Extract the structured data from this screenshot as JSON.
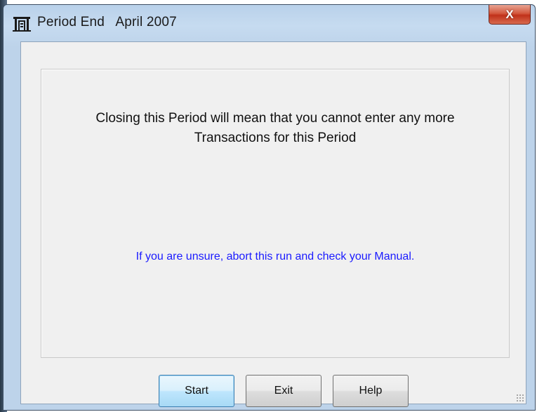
{
  "window": {
    "title": "Period End   April 2007",
    "close_label": "X"
  },
  "message": {
    "line1": "Closing this Period will mean that you cannot enter any more",
    "line2": "Transactions for this Period",
    "hint": "If you are unsure, abort this run and check your Manual."
  },
  "buttons": {
    "start": "Start",
    "exit": "Exit",
    "help": "Help"
  },
  "colors": {
    "hint_text": "#1a1aff",
    "close_button": "#c0311a"
  }
}
